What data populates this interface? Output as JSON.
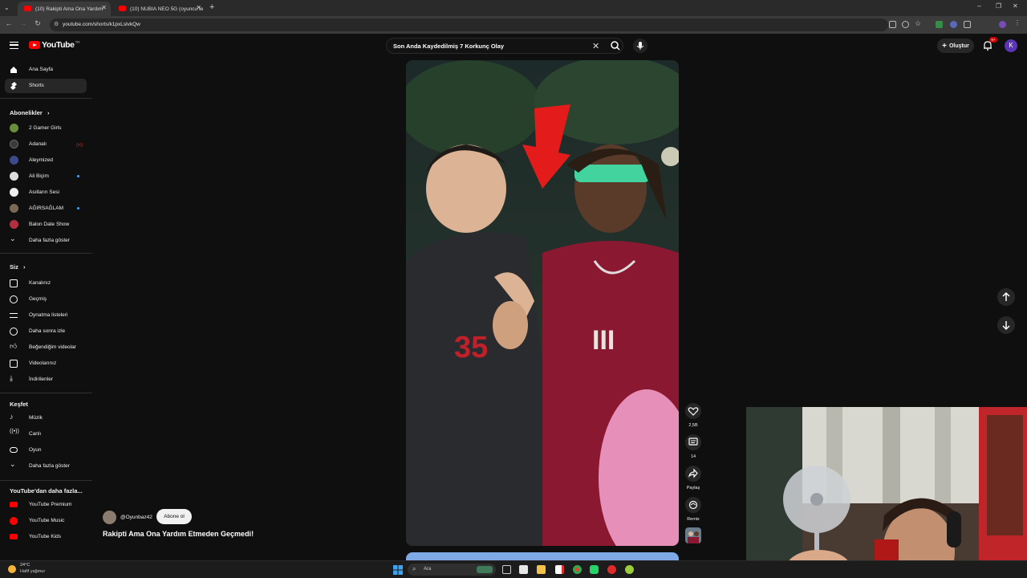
{
  "browser": {
    "tabs": [
      {
        "title": "(10) Rakipti Ama Ona Yardım",
        "active": true
      },
      {
        "title": "(10) NUBIA NEO 5G (oyuncu te",
        "active": false
      }
    ],
    "url": "youtube.com/shorts/k1pxLslvkQw"
  },
  "masthead": {
    "logo_text": "YouTube",
    "logo_region": "TR",
    "search_query": "Son Anda Kaydedilmiş 7 Korkunç Olay",
    "create_label": "Oluştur",
    "notification_count": "9+",
    "avatar_letter": "K"
  },
  "sidebar": {
    "main": [
      {
        "label": "Ana Sayfa",
        "icon": "home-icon"
      },
      {
        "label": "Shorts",
        "icon": "shorts-icon",
        "selected": true
      }
    ],
    "subscriptions_title": "Abonelikler",
    "subscriptions": [
      {
        "label": "2 Gamer Girls",
        "color": "#6a8f3a"
      },
      {
        "label": "Adanalı",
        "color": "#3a3a3a",
        "live": true
      },
      {
        "label": "Aleymized",
        "color": "#3c4a8a"
      },
      {
        "label": "Ali Biçim",
        "color": "#dddddd",
        "dot": true
      },
      {
        "label": "Asılların Sesi",
        "color": "#eeeeee"
      },
      {
        "label": "AĞIRSAĞLAM",
        "color": "#7a6a55",
        "dot": true
      },
      {
        "label": "Balon Date Show",
        "color": "#b03040"
      }
    ],
    "show_more": "Daha fazla göster",
    "you_title": "Siz",
    "you": [
      {
        "label": "Kanalınız",
        "icon": "user-icon"
      },
      {
        "label": "Geçmiş",
        "icon": "history-icon"
      },
      {
        "label": "Oynatma listeleri",
        "icon": "playlist-icon"
      },
      {
        "label": "Daha sonra izle",
        "icon": "clock-icon"
      },
      {
        "label": "Beğendiğim videolar",
        "icon": "like-icon"
      },
      {
        "label": "Videolarınız",
        "icon": "video-icon"
      },
      {
        "label": "İndirilenler",
        "icon": "download-icon"
      }
    ],
    "explore_title": "Keşfet",
    "explore": [
      {
        "label": "Müzik",
        "icon": "music-icon"
      },
      {
        "label": "Canlı",
        "icon": "live-icon"
      },
      {
        "label": "Oyun",
        "icon": "game-icon"
      },
      {
        "label": "Daha fazla göster",
        "icon": "chevron-down-icon"
      }
    ],
    "more_title": "YouTube'dan daha fazla...",
    "more": [
      {
        "label": "YouTube Premium"
      },
      {
        "label": "YouTube Music"
      },
      {
        "label": "YouTube Kids"
      }
    ]
  },
  "short": {
    "channel": "@Oyunbaz42",
    "subscribe_label": "Abone ol",
    "title": "Rakipti Ama Ona Yardım Etmeden Geçmedi!",
    "likes": "2,5B",
    "comments": "14",
    "share_label": "Paylaş",
    "remix_label": "Remix"
  },
  "taskbar": {
    "temperature": "24°C",
    "weather": "Hafif yağmur",
    "search_placeholder": "Ara"
  }
}
